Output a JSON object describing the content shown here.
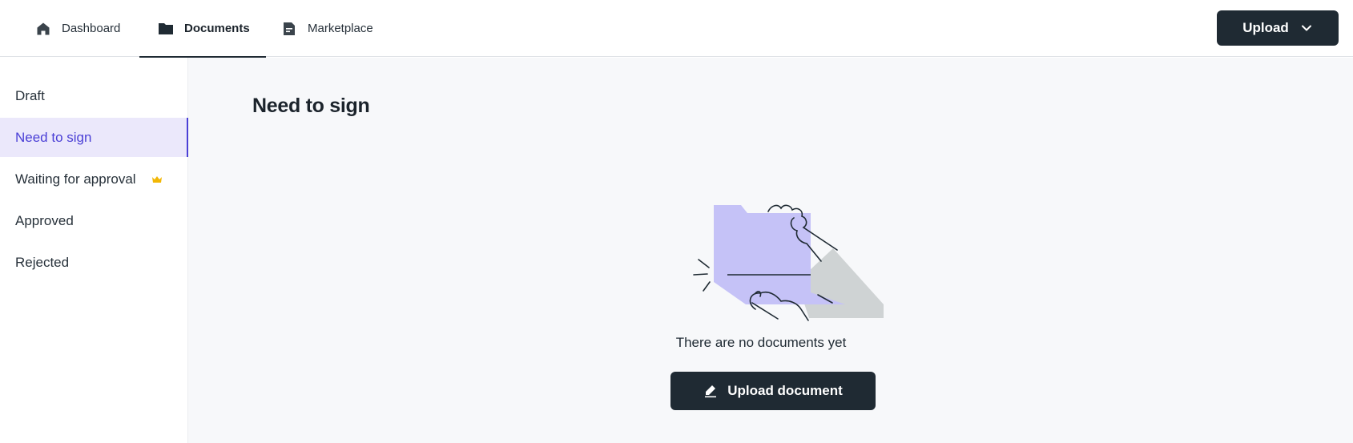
{
  "nav": {
    "tabs": [
      {
        "label": "Dashboard",
        "icon": "home-icon",
        "active": false
      },
      {
        "label": "Documents",
        "icon": "folder-icon",
        "active": true
      },
      {
        "label": "Marketplace",
        "icon": "document-icon",
        "active": false
      }
    ],
    "upload_label": "Upload"
  },
  "sidebar": {
    "items": [
      {
        "label": "Draft",
        "active": false
      },
      {
        "label": "Need to sign",
        "active": true
      },
      {
        "label": "Waiting for approval",
        "active": false,
        "badge_icon": "crown-icon"
      },
      {
        "label": "Approved",
        "active": false
      },
      {
        "label": "Rejected",
        "active": false
      }
    ]
  },
  "main": {
    "title": "Need to sign",
    "empty_message": "There are no documents yet",
    "upload_document_label": "Upload document"
  },
  "colors": {
    "dark": "#1f2a33",
    "accent": "#4a3fd6",
    "accent_bg": "#ebe8fb",
    "folder": "#c5c2f7",
    "crown": "#f2b705",
    "shadow": "#cfd3d4"
  }
}
